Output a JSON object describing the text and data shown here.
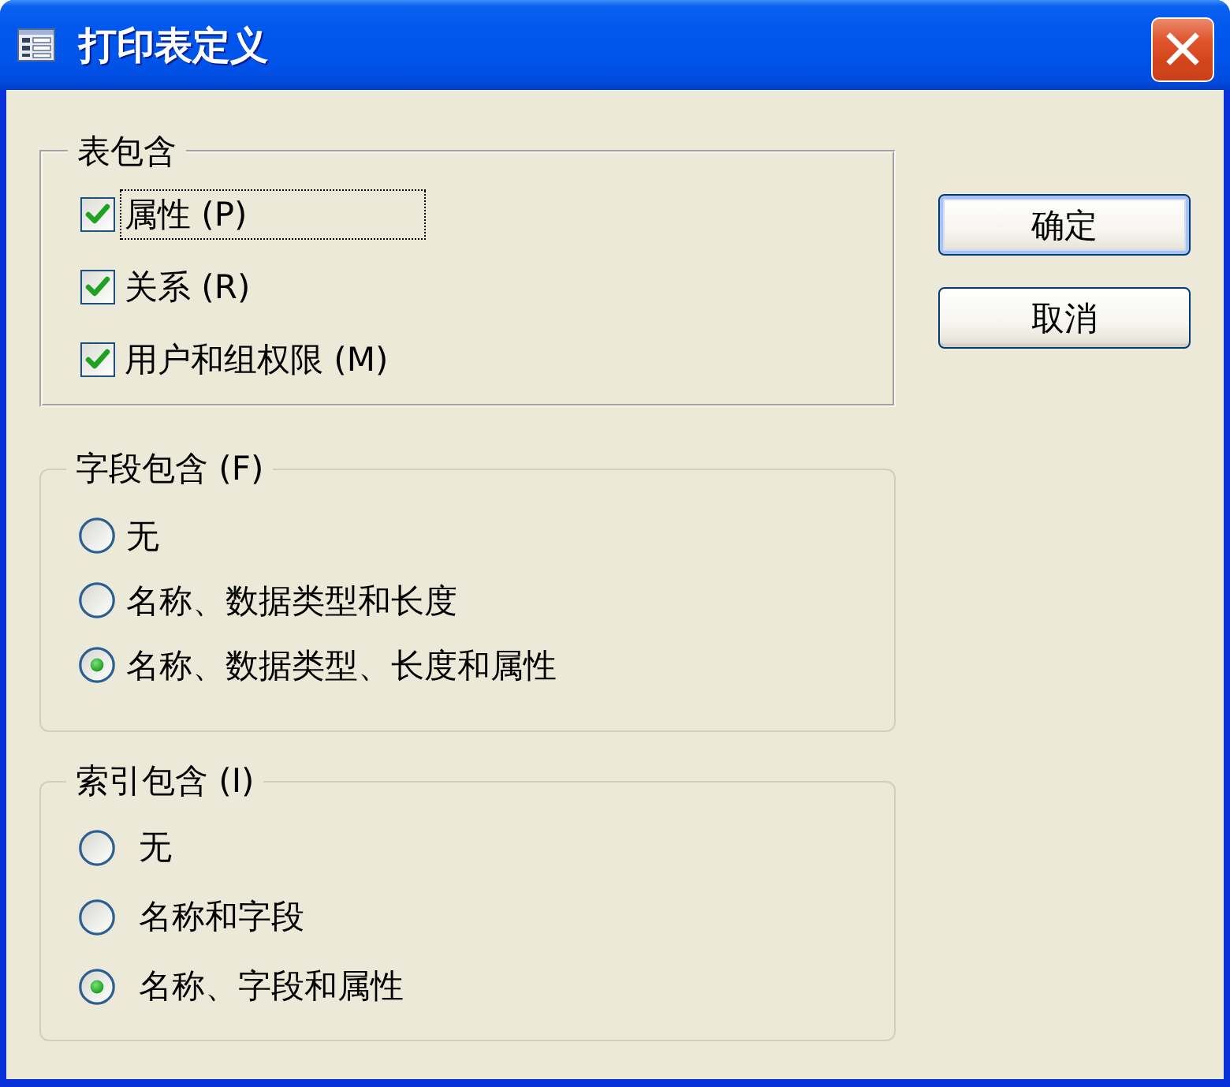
{
  "window": {
    "title": "打印表定义"
  },
  "groups": [
    {
      "kind": "checkbox",
      "title": "表包含",
      "options": [
        {
          "label": "属性 (P)",
          "checked": true,
          "focused": true
        },
        {
          "label": "关系 (R)",
          "checked": true,
          "focused": false
        },
        {
          "label": "用户和组权限 (M)",
          "checked": true,
          "focused": false
        }
      ]
    },
    {
      "kind": "radio",
      "title": "字段包含 (F)",
      "options": [
        {
          "label": "无",
          "selected": false
        },
        {
          "label": "名称、数据类型和长度",
          "selected": false
        },
        {
          "label": "名称、数据类型、长度和属性",
          "selected": true
        }
      ]
    },
    {
      "kind": "radio",
      "title": "索引包含 (I)",
      "options": [
        {
          "label": "无",
          "selected": false
        },
        {
          "label": "名称和字段",
          "selected": false
        },
        {
          "label": "名称、字段和属性",
          "selected": true
        }
      ]
    }
  ],
  "buttons": [
    {
      "label": "确定",
      "default": true
    },
    {
      "label": "取消",
      "default": false
    }
  ]
}
